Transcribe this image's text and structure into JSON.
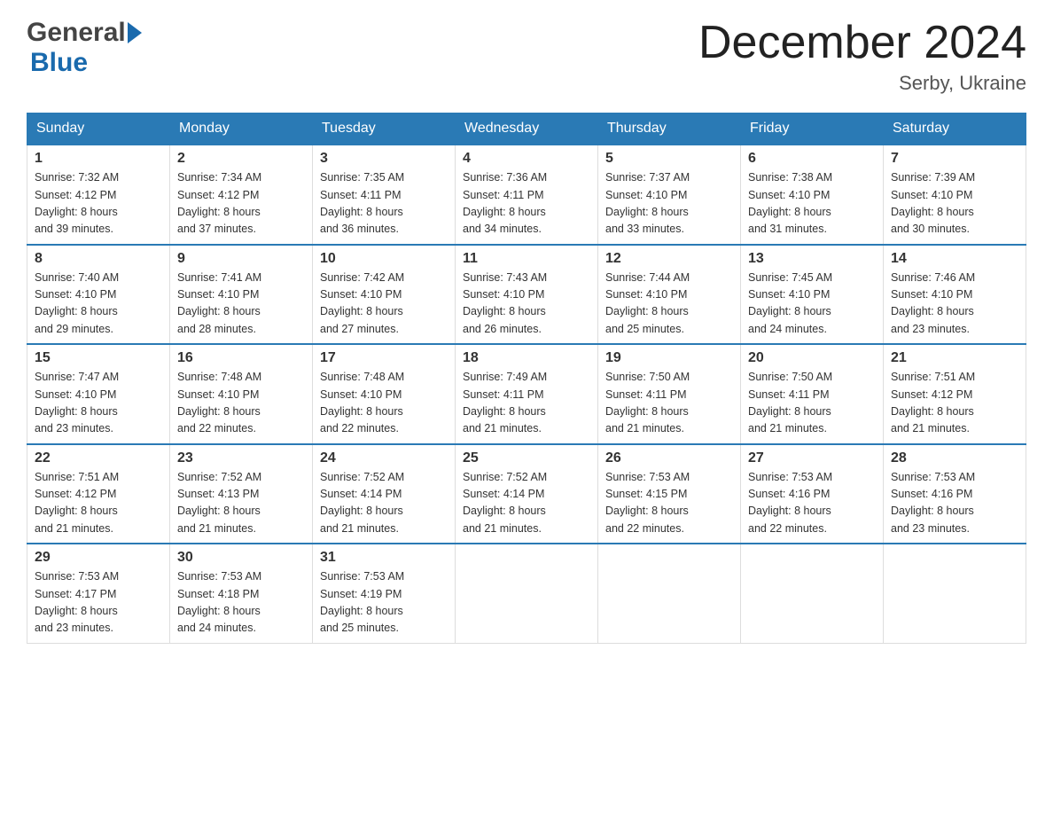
{
  "header": {
    "month_title": "December 2024",
    "location": "Serby, Ukraine",
    "logo_general": "General",
    "logo_blue": "Blue"
  },
  "weekdays": [
    "Sunday",
    "Monday",
    "Tuesday",
    "Wednesday",
    "Thursday",
    "Friday",
    "Saturday"
  ],
  "weeks": [
    [
      {
        "day": "1",
        "sunrise": "7:32 AM",
        "sunset": "4:12 PM",
        "daylight": "8 hours and 39 minutes."
      },
      {
        "day": "2",
        "sunrise": "7:34 AM",
        "sunset": "4:12 PM",
        "daylight": "8 hours and 37 minutes."
      },
      {
        "day": "3",
        "sunrise": "7:35 AM",
        "sunset": "4:11 PM",
        "daylight": "8 hours and 36 minutes."
      },
      {
        "day": "4",
        "sunrise": "7:36 AM",
        "sunset": "4:11 PM",
        "daylight": "8 hours and 34 minutes."
      },
      {
        "day": "5",
        "sunrise": "7:37 AM",
        "sunset": "4:10 PM",
        "daylight": "8 hours and 33 minutes."
      },
      {
        "day": "6",
        "sunrise": "7:38 AM",
        "sunset": "4:10 PM",
        "daylight": "8 hours and 31 minutes."
      },
      {
        "day": "7",
        "sunrise": "7:39 AM",
        "sunset": "4:10 PM",
        "daylight": "8 hours and 30 minutes."
      }
    ],
    [
      {
        "day": "8",
        "sunrise": "7:40 AM",
        "sunset": "4:10 PM",
        "daylight": "8 hours and 29 minutes."
      },
      {
        "day": "9",
        "sunrise": "7:41 AM",
        "sunset": "4:10 PM",
        "daylight": "8 hours and 28 minutes."
      },
      {
        "day": "10",
        "sunrise": "7:42 AM",
        "sunset": "4:10 PM",
        "daylight": "8 hours and 27 minutes."
      },
      {
        "day": "11",
        "sunrise": "7:43 AM",
        "sunset": "4:10 PM",
        "daylight": "8 hours and 26 minutes."
      },
      {
        "day": "12",
        "sunrise": "7:44 AM",
        "sunset": "4:10 PM",
        "daylight": "8 hours and 25 minutes."
      },
      {
        "day": "13",
        "sunrise": "7:45 AM",
        "sunset": "4:10 PM",
        "daylight": "8 hours and 24 minutes."
      },
      {
        "day": "14",
        "sunrise": "7:46 AM",
        "sunset": "4:10 PM",
        "daylight": "8 hours and 23 minutes."
      }
    ],
    [
      {
        "day": "15",
        "sunrise": "7:47 AM",
        "sunset": "4:10 PM",
        "daylight": "8 hours and 23 minutes."
      },
      {
        "day": "16",
        "sunrise": "7:48 AM",
        "sunset": "4:10 PM",
        "daylight": "8 hours and 22 minutes."
      },
      {
        "day": "17",
        "sunrise": "7:48 AM",
        "sunset": "4:10 PM",
        "daylight": "8 hours and 22 minutes."
      },
      {
        "day": "18",
        "sunrise": "7:49 AM",
        "sunset": "4:11 PM",
        "daylight": "8 hours and 21 minutes."
      },
      {
        "day": "19",
        "sunrise": "7:50 AM",
        "sunset": "4:11 PM",
        "daylight": "8 hours and 21 minutes."
      },
      {
        "day": "20",
        "sunrise": "7:50 AM",
        "sunset": "4:11 PM",
        "daylight": "8 hours and 21 minutes."
      },
      {
        "day": "21",
        "sunrise": "7:51 AM",
        "sunset": "4:12 PM",
        "daylight": "8 hours and 21 minutes."
      }
    ],
    [
      {
        "day": "22",
        "sunrise": "7:51 AM",
        "sunset": "4:12 PM",
        "daylight": "8 hours and 21 minutes."
      },
      {
        "day": "23",
        "sunrise": "7:52 AM",
        "sunset": "4:13 PM",
        "daylight": "8 hours and 21 minutes."
      },
      {
        "day": "24",
        "sunrise": "7:52 AM",
        "sunset": "4:14 PM",
        "daylight": "8 hours and 21 minutes."
      },
      {
        "day": "25",
        "sunrise": "7:52 AM",
        "sunset": "4:14 PM",
        "daylight": "8 hours and 21 minutes."
      },
      {
        "day": "26",
        "sunrise": "7:53 AM",
        "sunset": "4:15 PM",
        "daylight": "8 hours and 22 minutes."
      },
      {
        "day": "27",
        "sunrise": "7:53 AM",
        "sunset": "4:16 PM",
        "daylight": "8 hours and 22 minutes."
      },
      {
        "day": "28",
        "sunrise": "7:53 AM",
        "sunset": "4:16 PM",
        "daylight": "8 hours and 23 minutes."
      }
    ],
    [
      {
        "day": "29",
        "sunrise": "7:53 AM",
        "sunset": "4:17 PM",
        "daylight": "8 hours and 23 minutes."
      },
      {
        "day": "30",
        "sunrise": "7:53 AM",
        "sunset": "4:18 PM",
        "daylight": "8 hours and 24 minutes."
      },
      {
        "day": "31",
        "sunrise": "7:53 AM",
        "sunset": "4:19 PM",
        "daylight": "8 hours and 25 minutes."
      },
      null,
      null,
      null,
      null
    ]
  ],
  "labels": {
    "sunrise": "Sunrise:",
    "sunset": "Sunset:",
    "daylight": "Daylight:"
  }
}
